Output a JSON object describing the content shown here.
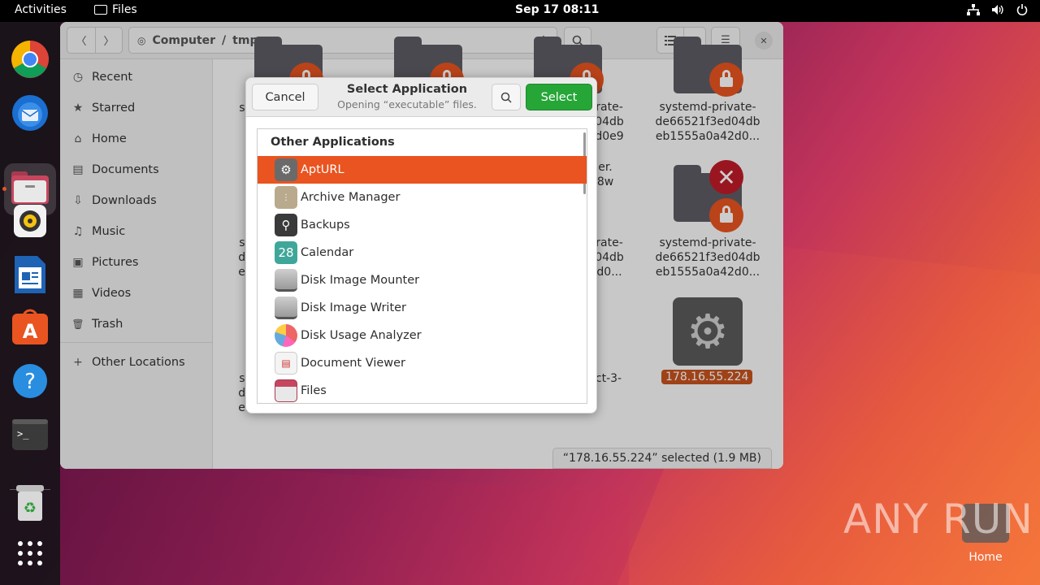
{
  "topbar": {
    "activities": "Activities",
    "app_name": "Files",
    "clock": "Sep 17  08:11"
  },
  "dock": {
    "items": [
      "chrome-icon",
      "thunderbird-icon",
      "files-icon",
      "rhythmbox-icon",
      "writer-icon",
      "app-center-icon",
      "help-icon",
      "terminal-icon",
      "trash-icon",
      "show-apps-icon"
    ]
  },
  "window": {
    "path": {
      "root": "Computer",
      "sep": "/",
      "current": "tmp"
    },
    "sidebar": {
      "items": [
        {
          "label": "Recent",
          "icon": "clock-icon",
          "glyph": "◷"
        },
        {
          "label": "Starred",
          "icon": "star-icon",
          "glyph": "★"
        },
        {
          "label": "Home",
          "icon": "home-icon",
          "glyph": "⌂"
        },
        {
          "label": "Documents",
          "icon": "document-icon",
          "glyph": "▤"
        },
        {
          "label": "Downloads",
          "icon": "download-icon",
          "glyph": "⇩"
        },
        {
          "label": "Music",
          "icon": "music-icon",
          "glyph": "♫"
        },
        {
          "label": "Pictures",
          "icon": "picture-icon",
          "glyph": "▣"
        },
        {
          "label": "Videos",
          "icon": "video-icon",
          "glyph": "▦"
        },
        {
          "label": "Trash",
          "icon": "trash-icon",
          "glyph": "🗑"
        }
      ],
      "other_locations": "Other Locations"
    },
    "files": {
      "left_col_1": "sy",
      "left_col_2": [
        "sy",
        "de",
        "eb"
      ],
      "left_col_3": [
        "sy",
        "de",
        "eb"
      ],
      "mid_1": [
        "rate-",
        "04db",
        "d0e9"
      ],
      "mid_2": [
        "er.",
        "8w"
      ],
      "mid_3": [
        "rate-",
        "04db",
        "d0..."
      ],
      "mid_4": "ct-3-",
      "right_1": [
        "systemd-private-",
        "de66521f3ed04db",
        "eb1555a0a42d0..."
      ],
      "right_2": [
        "systemd-private-",
        "de66521f3ed04db",
        "eb1555a0a42d0..."
      ],
      "selected": "178.16.55.224"
    },
    "status": "“178.16.55.224” selected  (1.9 MB)"
  },
  "dialog": {
    "cancel": "Cancel",
    "title": "Select Application",
    "subtitle": "Opening “executable” files.",
    "select": "Select",
    "list_heading": "Other Applications",
    "apps": [
      {
        "label": "AptURL",
        "icon": "gear-icon",
        "selected": true
      },
      {
        "label": "Archive Manager",
        "icon": "archive-icon",
        "selected": false
      },
      {
        "label": "Backups",
        "icon": "backup-icon",
        "selected": false
      },
      {
        "label": "Calendar",
        "icon": "calendar-icon",
        "glyph": "28",
        "selected": false
      },
      {
        "label": "Disk Image Mounter",
        "icon": "disk-icon",
        "selected": false
      },
      {
        "label": "Disk Image Writer",
        "icon": "disk-icon",
        "selected": false
      },
      {
        "label": "Disk Usage Analyzer",
        "icon": "pie-icon",
        "selected": false
      },
      {
        "label": "Document Viewer",
        "icon": "document-viewer-icon",
        "selected": false
      },
      {
        "label": "Files",
        "icon": "files-icon",
        "selected": false
      }
    ]
  },
  "desktop": {
    "home_label": "Home",
    "watermark": "ANY RUN"
  },
  "colors": {
    "accent": "#e95420",
    "select_button": "#26a637"
  }
}
